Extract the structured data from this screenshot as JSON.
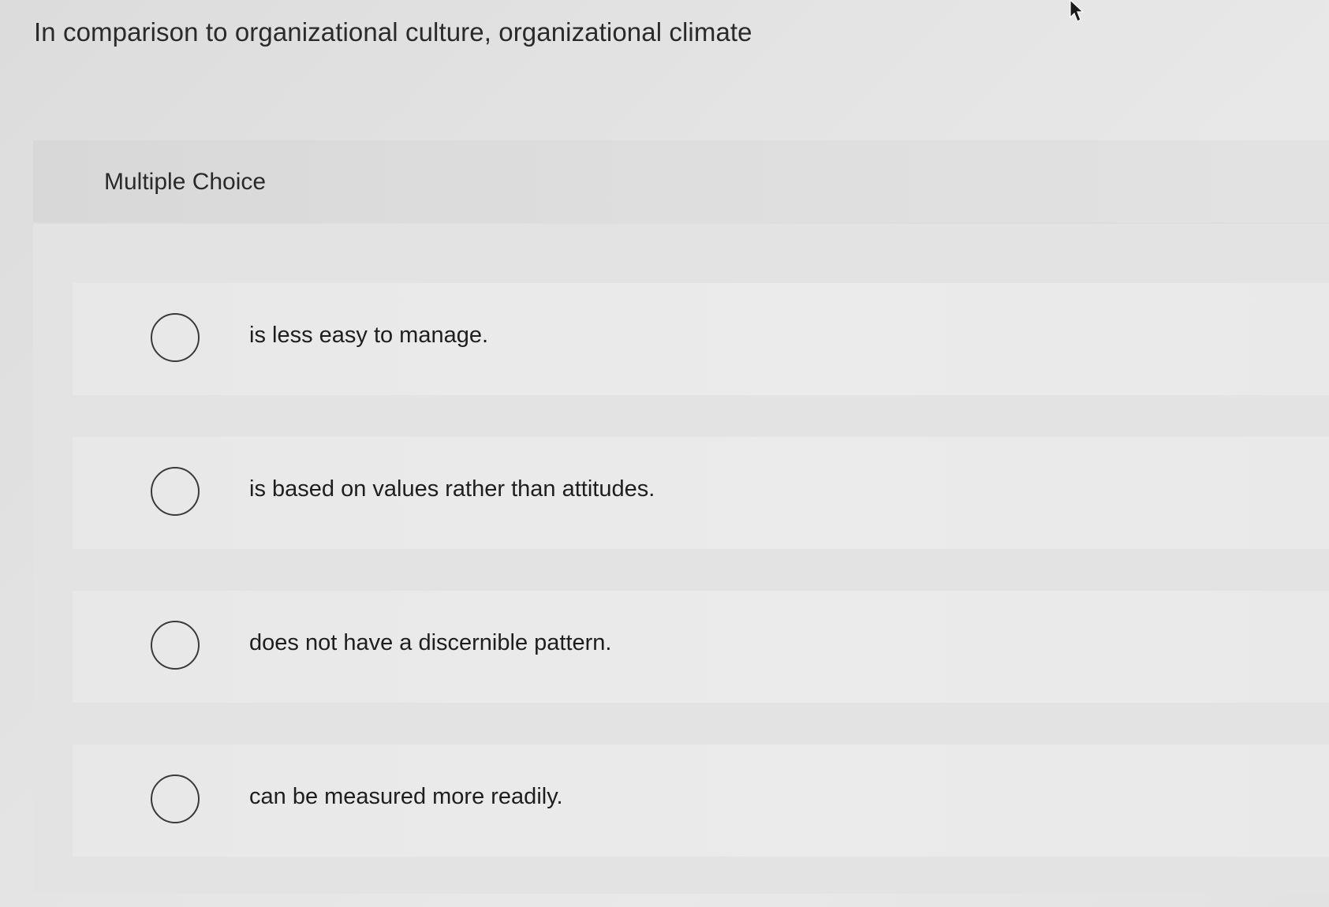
{
  "question": {
    "text": "In comparison to organizational culture, organizational climate"
  },
  "panel": {
    "label": "Multiple Choice"
  },
  "options": [
    {
      "text": "is less easy to manage.",
      "selected": false
    },
    {
      "text": "is based on values rather than attitudes.",
      "selected": false
    },
    {
      "text": "does not have a discernible pattern.",
      "selected": false
    },
    {
      "text": "can be measured more readily.",
      "selected": false
    }
  ],
  "icons": {
    "cursor": "mouse-pointer-icon",
    "radio": "radio-unchecked-icon"
  }
}
